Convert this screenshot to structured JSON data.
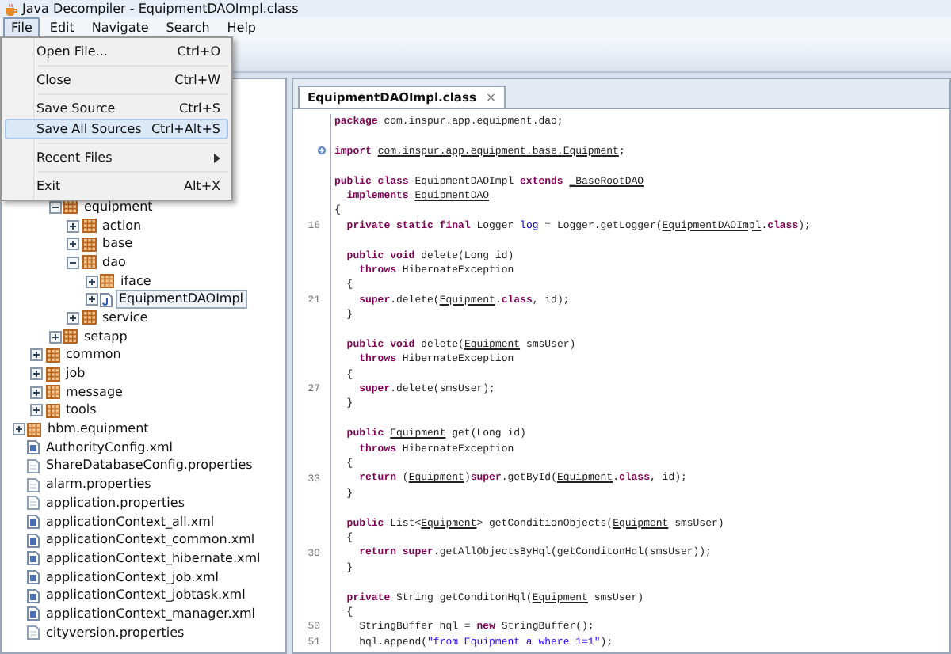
{
  "window": {
    "title": "Java Decompiler - EquipmentDAOImpl.class"
  },
  "menubar": [
    {
      "label": "File",
      "selected": true
    },
    {
      "label": "Edit",
      "selected": false
    },
    {
      "label": "Navigate",
      "selected": false
    },
    {
      "label": "Search",
      "selected": false
    },
    {
      "label": "Help",
      "selected": false
    }
  ],
  "file_menu": {
    "groups": [
      [
        {
          "label": "Open File...",
          "shortcut": "Ctrl+O",
          "selected": false
        }
      ],
      [
        {
          "label": "Close",
          "shortcut": "Ctrl+W",
          "selected": false
        }
      ],
      [
        {
          "label": "Save Source",
          "shortcut": "Ctrl+S",
          "selected": false
        },
        {
          "label": "Save All Sources",
          "shortcut": "Ctrl+Alt+S",
          "selected": true
        }
      ],
      [
        {
          "label": "Recent Files",
          "submenu": true,
          "selected": false
        }
      ],
      [
        {
          "label": "Exit",
          "shortcut": "Alt+X",
          "selected": false
        }
      ]
    ]
  },
  "tree": [
    {
      "children": [
        {
          "children": [
            {
              "label": "equipment",
              "kind": "package",
              "expanded": true,
              "selected": false,
              "children": [
                {
                  "label": "action",
                  "kind": "package",
                  "expanded": false,
                  "selected": false
                },
                {
                  "label": "base",
                  "kind": "package",
                  "expanded": false,
                  "selected": false
                },
                {
                  "label": "dao",
                  "kind": "package",
                  "expanded": true,
                  "selected": false,
                  "children": [
                    {
                      "label": "iface",
                      "kind": "package",
                      "expanded": false,
                      "selected": false
                    },
                    {
                      "label": "EquipmentDAOImpl",
                      "kind": "class",
                      "expanded": false,
                      "selected": true
                    }
                  ]
                },
                {
                  "label": "service",
                  "kind": "package",
                  "expanded": false,
                  "selected": false
                }
              ]
            },
            {
              "label": "setapp",
              "kind": "package",
              "expanded": false,
              "selected": false
            }
          ]
        },
        {
          "label": "common",
          "kind": "package",
          "expanded": false,
          "selected": false
        },
        {
          "label": "job",
          "kind": "package",
          "expanded": false,
          "selected": false
        },
        {
          "label": "message",
          "kind": "package",
          "expanded": false,
          "selected": false
        },
        {
          "label": "tools",
          "kind": "package",
          "expanded": false,
          "selected": false
        }
      ]
    },
    {
      "label": "hbm.equipment",
      "kind": "package",
      "expanded": false,
      "selected": false
    },
    {
      "label": "AuthorityConfig.xml",
      "kind": "xml",
      "selected": false
    },
    {
      "label": "ShareDatabaseConfig.properties",
      "kind": "properties",
      "selected": false
    },
    {
      "label": "alarm.properties",
      "kind": "properties",
      "selected": false
    },
    {
      "label": "application.properties",
      "kind": "properties",
      "selected": false
    },
    {
      "label": "applicationContext_all.xml",
      "kind": "xml",
      "selected": false
    },
    {
      "label": "applicationContext_common.xml",
      "kind": "xml",
      "selected": false
    },
    {
      "label": "applicationContext_hibernate.xml",
      "kind": "xml",
      "selected": false
    },
    {
      "label": "applicationContext_job.xml",
      "kind": "xml",
      "selected": false
    },
    {
      "label": "applicationContext_jobtask.xml",
      "kind": "xml",
      "selected": false
    },
    {
      "label": "applicationContext_manager.xml",
      "kind": "xml",
      "selected": false
    },
    {
      "label": "cityversion.properties",
      "kind": "properties",
      "selected": false
    }
  ],
  "editor_tabs": [
    {
      "label": "EquipmentDAOImpl.class",
      "close": "×",
      "selected": true
    }
  ],
  "code_lines": [
    {
      "kind": "code",
      "tokens": [
        {
          "kind": "kw",
          "text": "package"
        },
        {
          "kind": "plain",
          "text": " com.inspur.app.equipment.dao;"
        }
      ]
    },
    {
      "kind": "blank"
    },
    {
      "kind": "code",
      "fold": true,
      "tokens": [
        {
          "kind": "kw",
          "text": "import "
        },
        {
          "kind": "ref",
          "text": "com.inspur.app.equipment.base.Equipment"
        },
        {
          "kind": "plain",
          "text": ";"
        }
      ]
    },
    {
      "kind": "blank"
    },
    {
      "kind": "code",
      "tokens": [
        {
          "kind": "kw",
          "text": "public class"
        },
        {
          "kind": "plain",
          "text": " EquipmentDAOImpl "
        },
        {
          "kind": "kw",
          "text": "extends "
        },
        {
          "kind": "ref",
          "text": "_BaseRootDAO"
        }
      ]
    },
    {
      "kind": "code",
      "tokens": [
        {
          "kind": "kw",
          "text": "  implements "
        },
        {
          "kind": "ref",
          "text": "EquipmentDAO"
        }
      ]
    },
    {
      "kind": "code",
      "tokens": [
        {
          "kind": "plain",
          "text": "{"
        }
      ]
    },
    {
      "kind": "code",
      "number": "16",
      "tokens": [
        {
          "kind": "kw",
          "text": "  private static final"
        },
        {
          "kind": "plain",
          "text": " Logger "
        },
        {
          "kind": "field",
          "text": "log"
        },
        {
          "kind": "plain",
          "text": " = Logger.getLogger("
        },
        {
          "kind": "ref",
          "text": "EquipmentDAOImpl"
        },
        {
          "kind": "plain",
          "text": "."
        },
        {
          "kind": "kw",
          "text": "class"
        },
        {
          "kind": "plain",
          "text": ");"
        }
      ]
    },
    {
      "kind": "blank"
    },
    {
      "kind": "code",
      "tokens": [
        {
          "kind": "kw",
          "text": "  public void"
        },
        {
          "kind": "plain",
          "text": " delete(Long id)"
        }
      ]
    },
    {
      "kind": "code",
      "tokens": [
        {
          "kind": "kw",
          "text": "    throws"
        },
        {
          "kind": "plain",
          "text": " HibernateException"
        }
      ]
    },
    {
      "kind": "code",
      "tokens": [
        {
          "kind": "plain",
          "text": "  {"
        }
      ]
    },
    {
      "kind": "code",
      "number": "21",
      "tokens": [
        {
          "kind": "kw",
          "text": "    super"
        },
        {
          "kind": "plain",
          "text": ".delete("
        },
        {
          "kind": "ref",
          "text": "Equipment"
        },
        {
          "kind": "plain",
          "text": "."
        },
        {
          "kind": "kw",
          "text": "class"
        },
        {
          "kind": "plain",
          "text": ", id);"
        }
      ]
    },
    {
      "kind": "code",
      "tokens": [
        {
          "kind": "plain",
          "text": "  }"
        }
      ]
    },
    {
      "kind": "blank"
    },
    {
      "kind": "code",
      "tokens": [
        {
          "kind": "kw",
          "text": "  public void"
        },
        {
          "kind": "plain",
          "text": " delete("
        },
        {
          "kind": "ref",
          "text": "Equipment"
        },
        {
          "kind": "plain",
          "text": " smsUser)"
        }
      ]
    },
    {
      "kind": "code",
      "tokens": [
        {
          "kind": "kw",
          "text": "    throws"
        },
        {
          "kind": "plain",
          "text": " HibernateException"
        }
      ]
    },
    {
      "kind": "code",
      "tokens": [
        {
          "kind": "plain",
          "text": "  {"
        }
      ]
    },
    {
      "kind": "code",
      "number": "27",
      "tokens": [
        {
          "kind": "kw",
          "text": "    super"
        },
        {
          "kind": "plain",
          "text": ".delete(smsUser);"
        }
      ]
    },
    {
      "kind": "code",
      "tokens": [
        {
          "kind": "plain",
          "text": "  }"
        }
      ]
    },
    {
      "kind": "blank"
    },
    {
      "kind": "code",
      "tokens": [
        {
          "kind": "kw",
          "text": "  public "
        },
        {
          "kind": "ref",
          "text": "Equipment"
        },
        {
          "kind": "plain",
          "text": " get(Long id)"
        }
      ]
    },
    {
      "kind": "code",
      "tokens": [
        {
          "kind": "kw",
          "text": "    throws"
        },
        {
          "kind": "plain",
          "text": " HibernateException"
        }
      ]
    },
    {
      "kind": "code",
      "tokens": [
        {
          "kind": "plain",
          "text": "  {"
        }
      ]
    },
    {
      "kind": "code",
      "number": "33",
      "tokens": [
        {
          "kind": "kw",
          "text": "    return"
        },
        {
          "kind": "plain",
          "text": " ("
        },
        {
          "kind": "ref",
          "text": "Equipment"
        },
        {
          "kind": "plain",
          "text": ")"
        },
        {
          "kind": "kw",
          "text": "super"
        },
        {
          "kind": "plain",
          "text": ".getById("
        },
        {
          "kind": "ref",
          "text": "Equipment"
        },
        {
          "kind": "plain",
          "text": "."
        },
        {
          "kind": "kw",
          "text": "class"
        },
        {
          "kind": "plain",
          "text": ", id);"
        }
      ]
    },
    {
      "kind": "code",
      "tokens": [
        {
          "kind": "plain",
          "text": "  }"
        }
      ]
    },
    {
      "kind": "blank"
    },
    {
      "kind": "code",
      "tokens": [
        {
          "kind": "kw",
          "text": "  public"
        },
        {
          "kind": "plain",
          "text": " List<"
        },
        {
          "kind": "ref",
          "text": "Equipment"
        },
        {
          "kind": "plain",
          "text": "> getConditionObjects("
        },
        {
          "kind": "ref",
          "text": "Equipment"
        },
        {
          "kind": "plain",
          "text": " smsUser)"
        }
      ]
    },
    {
      "kind": "code",
      "tokens": [
        {
          "kind": "plain",
          "text": "  {"
        }
      ]
    },
    {
      "kind": "code",
      "number": "39",
      "tokens": [
        {
          "kind": "kw",
          "text": "    return super"
        },
        {
          "kind": "plain",
          "text": ".getAllObjectsByHql(getConditonHql(smsUser));"
        }
      ]
    },
    {
      "kind": "code",
      "tokens": [
        {
          "kind": "plain",
          "text": "  }"
        }
      ]
    },
    {
      "kind": "blank"
    },
    {
      "kind": "code",
      "tokens": [
        {
          "kind": "kw",
          "text": "  private"
        },
        {
          "kind": "plain",
          "text": " String getConditonHql("
        },
        {
          "kind": "ref",
          "text": "Equipment"
        },
        {
          "kind": "plain",
          "text": " smsUser)"
        }
      ]
    },
    {
      "kind": "code",
      "tokens": [
        {
          "kind": "plain",
          "text": "  {"
        }
      ]
    },
    {
      "kind": "code",
      "number": "50",
      "tokens": [
        {
          "kind": "plain",
          "text": "    StringBuffer hql = "
        },
        {
          "kind": "kw",
          "text": "new"
        },
        {
          "kind": "plain",
          "text": " StringBuffer();"
        }
      ]
    },
    {
      "kind": "code",
      "number": "51",
      "tokens": [
        {
          "kind": "plain",
          "text": "    hql.append("
        },
        {
          "kind": "str",
          "text": "\"from Equipment a where 1=1\""
        },
        {
          "kind": "plain",
          "text": ");"
        }
      ]
    }
  ]
}
